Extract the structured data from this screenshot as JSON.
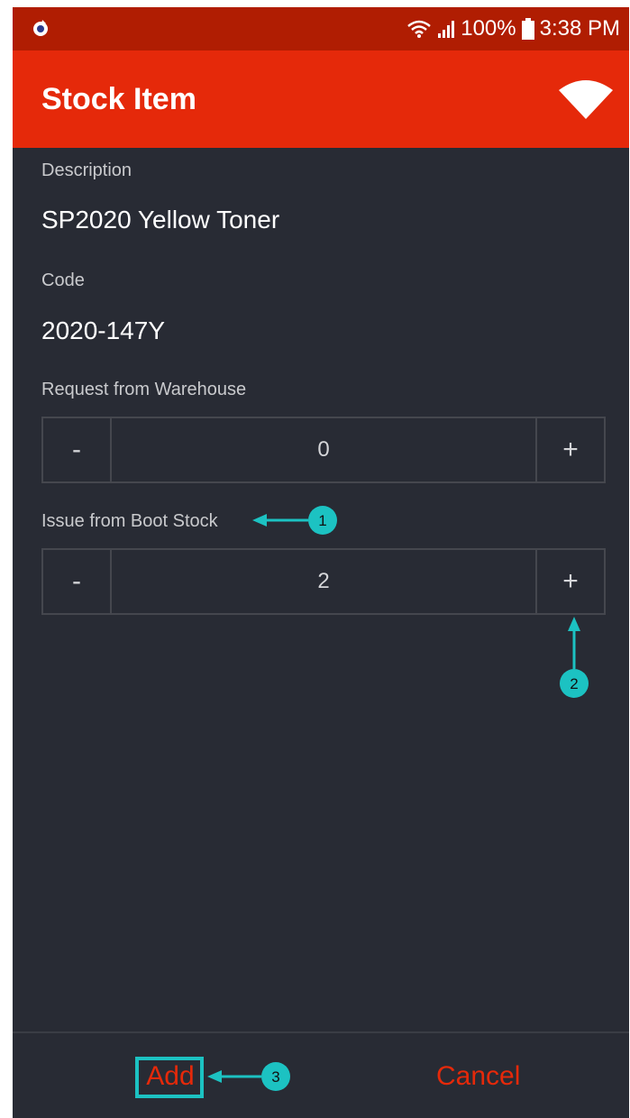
{
  "status_bar": {
    "battery": "100%",
    "time": "3:38 PM",
    "icons": [
      "app-notification-icon",
      "wifi-signal-icon",
      "cell-signal-icon",
      "battery-icon"
    ]
  },
  "app_bar": {
    "title": "Stock Item",
    "icon": "wifi-icon"
  },
  "item": {
    "description_label": "Description",
    "description": "SP2020 Yellow Toner",
    "code_label": "Code",
    "code": "2020-147Y"
  },
  "request_from_warehouse": {
    "label": "Request from Warehouse",
    "minus": "-",
    "quantity": "0",
    "plus": "+"
  },
  "issue_from_boot_stock": {
    "label": "Issue from Boot Stock",
    "minus": "-",
    "quantity": "2",
    "plus": "+"
  },
  "footer": {
    "add_label": "Add",
    "cancel_label": "Cancel"
  },
  "annotations": {
    "callout_1": "1",
    "callout_2": "2",
    "callout_3": "3"
  },
  "colors": {
    "status_bar": "#b01d02",
    "app_bar": "#e5290a",
    "background": "#282b34",
    "accent": "#e5290a",
    "callout": "#1cc2c2"
  }
}
